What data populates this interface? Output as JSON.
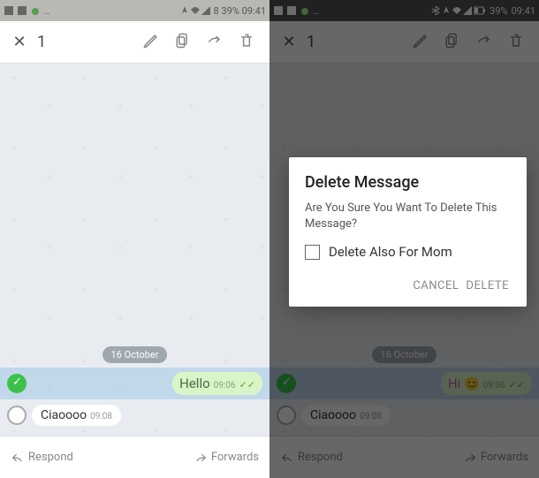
{
  "left": {
    "status": {
      "battery_text": "8 39% 09:41"
    },
    "selection": {
      "count": "1"
    },
    "chat": {
      "date_chip": "16 October",
      "out_msg": {
        "text": "Hello",
        "time": "09:06"
      },
      "in_msg": {
        "text": "Ciaoooo",
        "time": "09:08"
      }
    },
    "bottom": {
      "respond": "Respond",
      "forwards": "Forwards"
    }
  },
  "right": {
    "status": {
      "battery_text": "39%",
      "time": "09:41"
    },
    "selection": {
      "count": "1"
    },
    "chat": {
      "date_chip": "16 October",
      "out_msg": {
        "text": "Hi",
        "time": "09:06"
      },
      "in_msg": {
        "text": "Ciaoooo",
        "time": "09:08"
      }
    },
    "bottom": {
      "respond": "Respond",
      "forwards": "Forwards"
    },
    "dialog": {
      "title": "Delete Message",
      "body": "Are You Sure You Want To Delete This Message?",
      "checkbox_label": "Delete Also For Mom",
      "cancel": "CANCEL",
      "delete": "DELETE"
    }
  }
}
